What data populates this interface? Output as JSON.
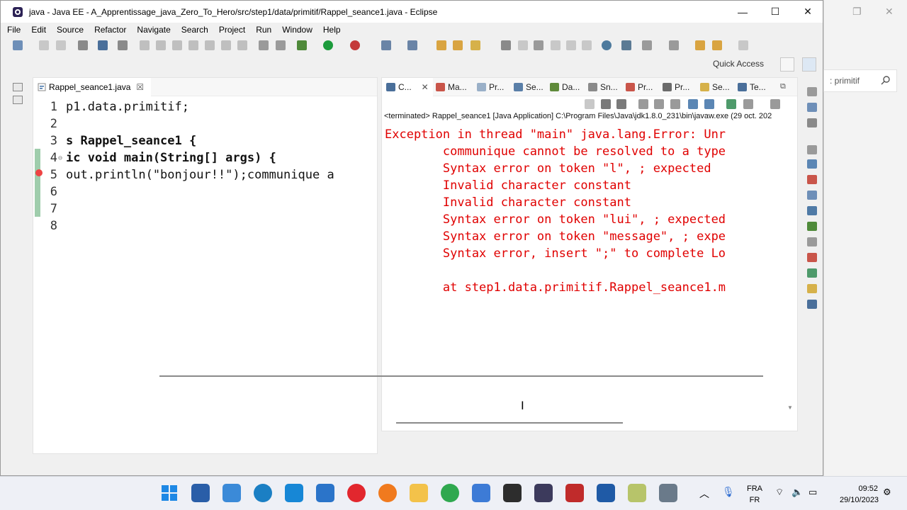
{
  "window": {
    "title": "java - Java EE - A_Apprentissage_java_Zero_To_Hero/src/step1/data/primitif/Rappel_seance1.java - Eclipse",
    "minimize": "—",
    "maximize": "☐",
    "close": "✕"
  },
  "menu": [
    "File",
    "Edit",
    "Source",
    "Refactor",
    "Navigate",
    "Search",
    "Project",
    "Run",
    "Window",
    "Help"
  ],
  "quick_access": "Quick Access",
  "background_window": {
    "search_text": ": primitif"
  },
  "editor": {
    "tab_label": "Rappel_seance1.java",
    "tab_close": "☒",
    "lines": [
      {
        "num": "1",
        "text": "p1.data.primitif;"
      },
      {
        "num": "2",
        "text": ""
      },
      {
        "num": "3",
        "text": "s Rappel_seance1 {"
      },
      {
        "num": "4",
        "text": "ic void main(String[] args) {"
      },
      {
        "num": "5",
        "text": "out.println(\"bonjour!!\");communique a"
      },
      {
        "num": "6",
        "text": ""
      },
      {
        "num": "7",
        "text": ""
      },
      {
        "num": "8",
        "text": ""
      }
    ]
  },
  "console": {
    "tabs": [
      "C...",
      "Ma...",
      "Pr...",
      "Se...",
      "Da...",
      "Sn...",
      "Pr...",
      "Pr...",
      "Se...",
      "Te..."
    ],
    "status": "<terminated> Rappel_seance1 [Java Application] C:\\Program Files\\Java\\jdk1.8.0_231\\bin\\javaw.exe (29 oct. 202",
    "output": [
      "Exception in thread \"main\" java.lang.Error: Unr",
      "        communique cannot be resolved to a type",
      "        Syntax error on token \"l\", ; expected",
      "        Invalid character constant",
      "        Invalid character constant",
      "        Syntax error on token \"lui\", ; expected",
      "        Syntax error on token \"message\", ; expe",
      "        Syntax error, insert \";\" to complete Lo",
      "",
      "        at step1.data.primitif.Rappel_seance1.m"
    ],
    "error_color": "#e00000"
  },
  "taskbar": {
    "lang_top": "FRA",
    "lang_bottom": "FR",
    "time": "09:52",
    "date": "29/10/2023"
  }
}
